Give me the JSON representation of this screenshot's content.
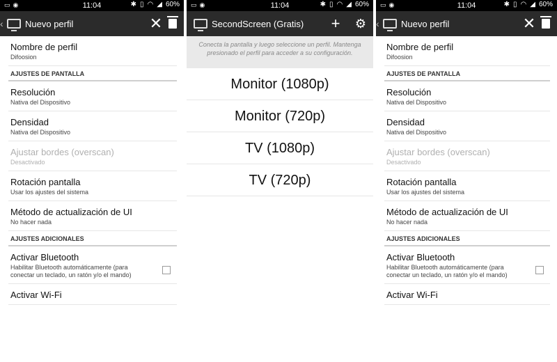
{
  "status": {
    "time": "11:04",
    "battery": "60%"
  },
  "left": {
    "title": "Nuevo perfil",
    "items": [
      {
        "title": "Nombre de perfil",
        "sub": "Difoosion"
      }
    ],
    "section1": "AJUSTES DE PANTALLA",
    "display_items": [
      {
        "title": "Resolución",
        "sub": "Nativa del Dispositivo"
      },
      {
        "title": "Densidad",
        "sub": "Nativa del Dispositivo"
      },
      {
        "title": "Ajustar bordes (overscan)",
        "sub": "Desactivado"
      },
      {
        "title": "Rotación pantalla",
        "sub": "Usar los ajustes del sistema"
      },
      {
        "title": "Método de actualización de UI",
        "sub": "No hacer nada"
      }
    ],
    "section2": "AJUSTES ADICIONALES",
    "bt": {
      "title": "Activar Bluetooth",
      "sub": "Habilitar Bluetooth automáticamente (para conectar un teclado, un ratón y/o el mando)"
    },
    "wifi": {
      "title": "Activar Wi-Fi"
    }
  },
  "middle": {
    "title": "SecondScreen (Gratis)",
    "hint": "Conecta la pantalla y luego seleccione un perfil. Mantenga presionado el perfil para acceder a su configuración.",
    "profiles": [
      "Monitor (1080p)",
      "Monitor (720p)",
      "TV (1080p)",
      "TV (720p)"
    ]
  }
}
